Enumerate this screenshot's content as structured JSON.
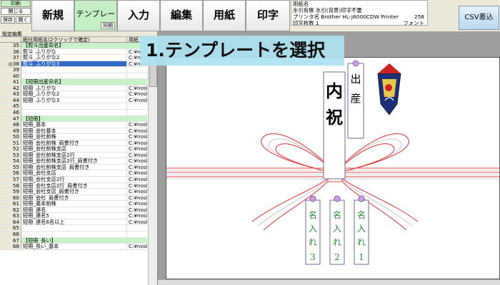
{
  "toolbar": {
    "mini_top": "印刷",
    "mini_open": "開じる",
    "mini_save": "保存",
    "mini_open2": "開く",
    "buttons": {
      "new": "新規",
      "template": "テンプレート",
      "template_sub": "同期",
      "input": "入力",
      "edit": "編集",
      "paper": "用紙",
      "print": "印字"
    },
    "csv": "CSV差込"
  },
  "printer_info": {
    "line0": "用紙名",
    "line1": "水引有無  水引(背景)印字不要",
    "line2_label": "プリンタ名  Brother HL-J6000CDW Printer",
    "line2_value": "258",
    "line3_label": "印字枚数  1",
    "line3_value": "フォント"
  },
  "left_panel": {
    "tab_label": "設定編集",
    "col_header_name": "紙付用紙名(2クリックで確定)",
    "col_header_path": "用紙",
    "rows": [
      {
        "no": "35",
        "name": "【熨斗出産命名】",
        "path": "",
        "header": true
      },
      {
        "no": "36",
        "name": "熨斗_ふりがな",
        "path": "C:¥nosl20",
        "header": false
      },
      {
        "no": "37",
        "name": "熨斗_ふりがな2",
        "path": "C:¥nosl20",
        "header": false
      },
      {
        "no": "◎38",
        "name": "熨斗_ふりがな3",
        "path": "C:¥nosl20",
        "header": false,
        "selected": true
      },
      {
        "no": "39",
        "name": "",
        "path": "",
        "header": false
      },
      {
        "no": "40",
        "name": "",
        "path": "",
        "header": false
      },
      {
        "no": "41",
        "name": "【短冊出産命名】",
        "path": "",
        "header": true
      },
      {
        "no": "42",
        "name": "短冊_ふりがな",
        "path": "C:¥nosl20",
        "header": false
      },
      {
        "no": "43",
        "name": "短冊_ふりがな2",
        "path": "C:¥nosl20",
        "header": false
      },
      {
        "no": "44",
        "name": "短冊_ふりがな3",
        "path": "C:¥nosl20",
        "header": false
      },
      {
        "no": "45",
        "name": "",
        "path": "",
        "header": false
      },
      {
        "no": "46",
        "name": "",
        "path": "",
        "header": false
      },
      {
        "no": "47",
        "name": "【短冊】",
        "path": "",
        "header": true
      },
      {
        "no": "48",
        "name": "短冊_基本",
        "path": "C:¥nosl20",
        "header": false
      },
      {
        "no": "49",
        "name": "短冊_会社基本",
        "path": "C:¥nosl20",
        "header": false
      },
      {
        "no": "50",
        "name": "短冊_会社前株",
        "path": "C:¥nosl20",
        "header": false
      },
      {
        "no": "51",
        "name": "短冊_会社前株_肩書付き",
        "path": "C:¥nosl20",
        "header": false
      },
      {
        "no": "52",
        "name": "短冊_会社前株支店",
        "path": "C:¥nosl20",
        "header": false
      },
      {
        "no": "53",
        "name": "短冊_会社前株支店2行",
        "path": "C:¥nosl20",
        "header": false
      },
      {
        "no": "54",
        "name": "短冊_会社前株支店2行_肩書付き",
        "path": "C:¥nosl20",
        "header": false
      },
      {
        "no": "55",
        "name": "短冊_会社前株支店_肩書付き",
        "path": "C:¥nosl20",
        "header": false
      },
      {
        "no": "56",
        "name": "短冊_会社支店",
        "path": "C:¥nosl20",
        "header": false
      },
      {
        "no": "57",
        "name": "短冊_会社支店2行",
        "path": "C:¥nosl20",
        "header": false
      },
      {
        "no": "58",
        "name": "短冊_会社支店2行_肩書付き",
        "path": "C:¥nosl20",
        "header": false
      },
      {
        "no": "59",
        "name": "短冊_会社支店_肩書付き",
        "path": "C:¥nosl20",
        "header": false
      },
      {
        "no": "60",
        "name": "短冊_会社_肩書付き",
        "path": "C:¥nosl20",
        "header": false
      },
      {
        "no": "61",
        "name": "短冊_基本前株",
        "path": "C:¥nosl20",
        "header": false
      },
      {
        "no": "62",
        "name": "短冊_連名",
        "path": "C:¥nosl20",
        "header": false
      },
      {
        "no": "63",
        "name": "短冊_連名5",
        "path": "C:¥nosl20",
        "header": false
      },
      {
        "no": "64",
        "name": "短冊_連名6名以上",
        "path": "C:¥nosl20",
        "header": false
      },
      {
        "no": "65",
        "name": "",
        "path": "",
        "header": false
      },
      {
        "no": "66",
        "name": "",
        "path": "",
        "header": false
      },
      {
        "no": "67",
        "name": "【短冊_長い】",
        "path": "",
        "header": true
      },
      {
        "no": "68",
        "name": "短冊_長い_基本",
        "path": "C:¥nosl20",
        "header": false
      }
    ]
  },
  "preview": {
    "main_chars": [
      "内",
      "祝"
    ],
    "tag_chars": [
      "出",
      "産"
    ],
    "small_tags": [
      {
        "chars": [
          "名",
          "入",
          "れ"
        ],
        "number": "3"
      },
      {
        "chars": [
          "名",
          "入",
          "れ"
        ],
        "number": "2"
      },
      {
        "chars": [
          "名",
          "入",
          "れ"
        ],
        "number": "1"
      }
    ]
  },
  "banner": "1.テンプレートを選択"
}
